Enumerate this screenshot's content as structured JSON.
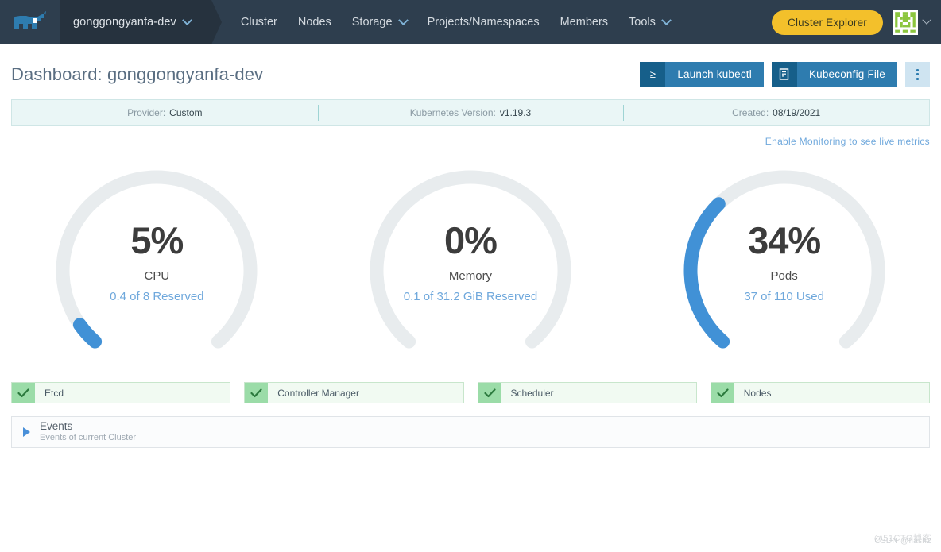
{
  "nav": {
    "logo_name": "rancher-logo",
    "cluster_selector_label": "gonggongyanfa-dev",
    "links": [
      {
        "label": "Cluster",
        "has_chevron": false
      },
      {
        "label": "Nodes",
        "has_chevron": false
      },
      {
        "label": "Storage",
        "has_chevron": true
      },
      {
        "label": "Projects/Namespaces",
        "has_chevron": false
      },
      {
        "label": "Members",
        "has_chevron": false
      },
      {
        "label": "Tools",
        "has_chevron": true
      }
    ],
    "cluster_explorer_label": "Cluster Explorer",
    "accent_yellow": "#F3C02B",
    "bar_color": "#2E3E4E"
  },
  "header": {
    "title": "Dashboard: gonggongyanfa-dev",
    "launch_kubectl_label": "Launch kubectl",
    "launch_kubectl_icon": "terminal-prompt-icon",
    "kubeconfig_label": "Kubeconfig File",
    "kubeconfig_icon": "file-document-icon",
    "kebab_label": "More actions",
    "button_color": "#2E7CAF"
  },
  "info_bar": [
    {
      "label": "Provider:",
      "value": "Custom"
    },
    {
      "label": "Kubernetes Version:",
      "value": "v1.19.3"
    },
    {
      "label": "Created:",
      "value": "08/19/2021"
    }
  ],
  "monitoring": {
    "link_text": "Enable Monitoring to see live metrics",
    "link_color": "#6FA8DC"
  },
  "gauges": [
    {
      "percent_text": "5%",
      "percent_value": 5,
      "label": "CPU",
      "sub": "0.4 of 8 Reserved",
      "fill_color": "#4191D6",
      "track_color": "#E8ECEE"
    },
    {
      "percent_text": "0%",
      "percent_value": 0,
      "label": "Memory",
      "sub": "0.1 of 31.2 GiB Reserved",
      "fill_color": "#4191D6",
      "track_color": "#E8ECEE"
    },
    {
      "percent_text": "34%",
      "percent_value": 34,
      "label": "Pods",
      "sub": "37 of 110 Used",
      "fill_color": "#4191D6",
      "track_color": "#E8ECEE"
    }
  ],
  "status_items": [
    {
      "label": "Etcd",
      "state": "healthy",
      "icon": "check-icon"
    },
    {
      "label": "Controller Manager",
      "state": "healthy",
      "icon": "check-icon"
    },
    {
      "label": "Scheduler",
      "state": "healthy",
      "icon": "check-icon"
    },
    {
      "label": "Nodes",
      "state": "healthy",
      "icon": "check-icon"
    }
  ],
  "events": {
    "title": "Events",
    "subtitle": "Events of current Cluster",
    "expanded": false
  },
  "watermark": {
    "line1": "@51CTO博客",
    "line2": "CSDN @flash2"
  }
}
